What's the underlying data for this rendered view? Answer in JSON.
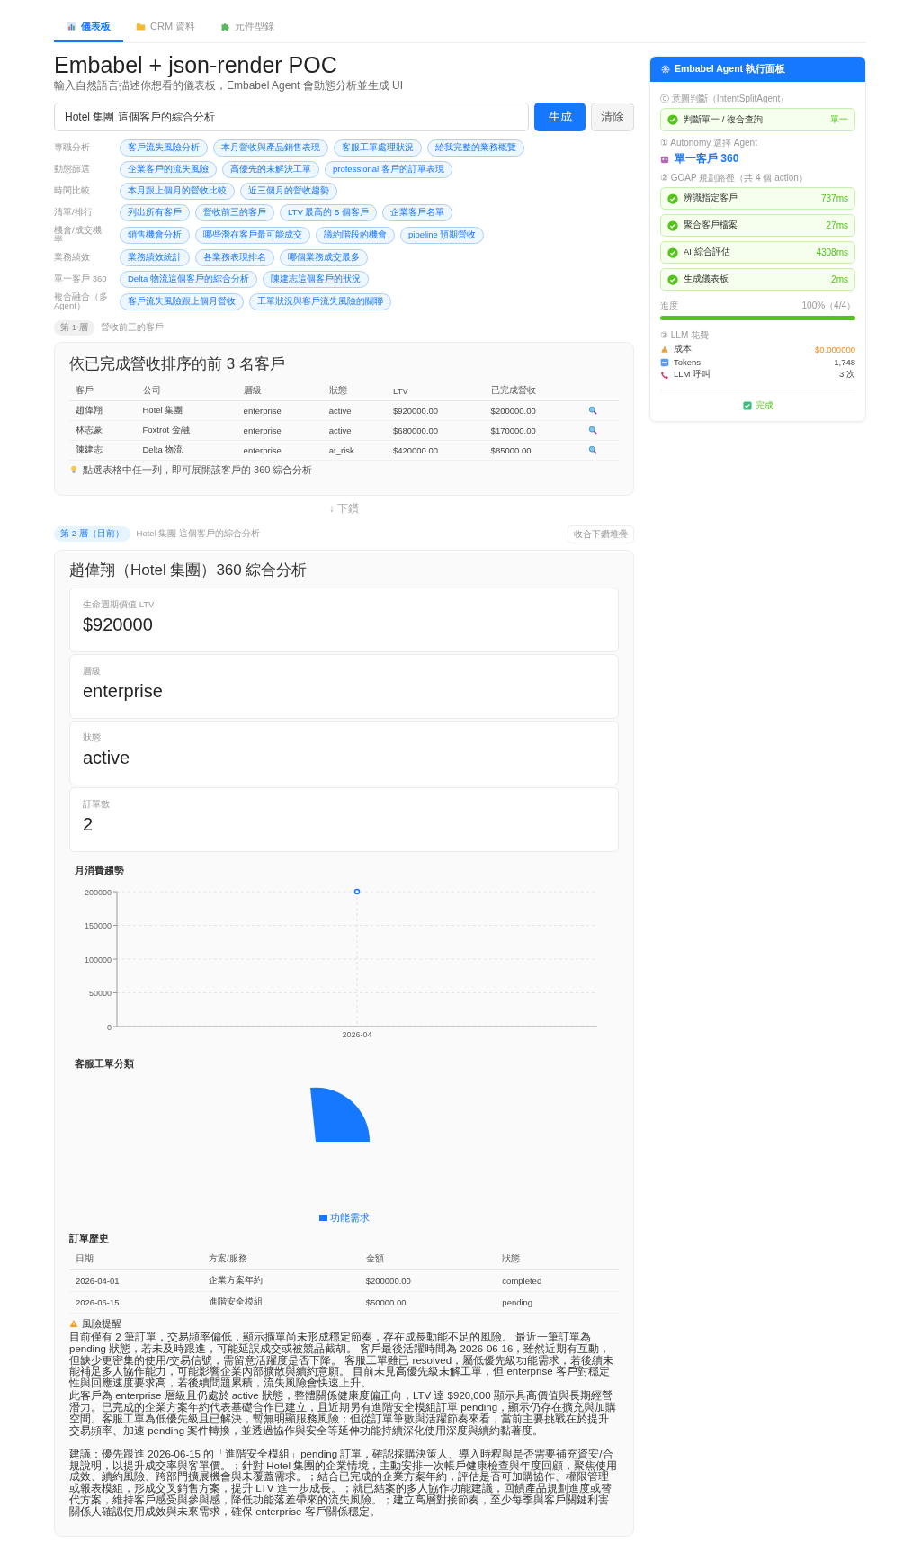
{
  "tabs": [
    {
      "label": "儀表板",
      "selected": true
    },
    {
      "label": "CRM 資料",
      "selected": false
    },
    {
      "label": "元件型錄",
      "selected": false
    }
  ],
  "header": {
    "title": "Embabel + json-render POC",
    "subtitle": "輸入自然語言描述你想看的儀表板，Embabel Agent 會動態分析並生成 UI"
  },
  "query": {
    "value": "Hotel 集團 這個客戶的綜合分析",
    "generate_button": "生成",
    "clear_button": "清除"
  },
  "suggestions": [
    {
      "category": "專職分析",
      "chips": [
        "客戶流失風險分析",
        "本月營收與產品銷售表現",
        "客服工單處理狀況",
        "給我完整的業務概覽"
      ]
    },
    {
      "category": "動態篩選",
      "chips": [
        "企業客戶的流失風險",
        "高優先的未解決工單",
        "professional 客戶的訂單表現"
      ]
    },
    {
      "category": "時間比較",
      "chips": [
        "本月跟上個月的營收比較",
        "近三個月的營收趨勢"
      ]
    },
    {
      "category": "清單/排行",
      "chips": [
        "列出所有客戶",
        "營收前三的客戶",
        "LTV 最高的 5 個客戶",
        "企業客戶名單"
      ]
    },
    {
      "category": "機會/成交機率",
      "chips": [
        "銷售機會分析",
        "哪些潛在客戶最可能成交",
        "議約階段的機會",
        "pipeline 預期營收"
      ]
    },
    {
      "category": "業務績效",
      "chips": [
        "業務績效統計",
        "各業務表現排名",
        "哪個業務成交最多"
      ]
    },
    {
      "category": "單一客戶 360",
      "chips": [
        "Delta 物流這個客戶的綜合分析",
        "陳建志這個客戶的狀況"
      ]
    },
    {
      "category": "複合融合（多 Agent）",
      "chips": [
        "客戶流失風險跟上個月營收",
        "工單狀況與客戶流失風險的關聯"
      ]
    }
  ],
  "layer_1": {
    "badge": "第 1 層",
    "caption": "營收前三的客戶",
    "current": false,
    "card": {
      "title": "依已完成營收排序的前 3 名客戶",
      "columns": [
        "客戶",
        "公司",
        "層級",
        "狀態",
        "LTV",
        "已完成營收"
      ],
      "rows": [
        [
          "趙偉翔",
          "Hotel 集團",
          "enterprise",
          "active",
          "$920000.00",
          "$200000.00"
        ],
        [
          "林志豪",
          "Foxtrot 金融",
          "enterprise",
          "active",
          "$680000.00",
          "$170000.00"
        ],
        [
          "陳建志",
          "Delta 物流",
          "enterprise",
          "at_risk",
          "$420000.00",
          "$85000.00"
        ]
      ],
      "hint": "點選表格中任一列，即可展開該客戶的 360 綜合分析"
    }
  },
  "drill_label": "↓ 下鑽",
  "layer_2": {
    "badge": "第 2 層（目前）",
    "caption": "Hotel 集團 這個客戶的綜合分析",
    "current": true,
    "collapse_button": "收合下鑽堆疊",
    "card": {
      "title": "趙偉翔（Hotel 集團）360 綜合分析",
      "stats": [
        {
          "label": "生命週期價值 LTV",
          "value": "$920000"
        },
        {
          "label": "層級",
          "value": "enterprise"
        },
        {
          "label": "狀態",
          "value": "active"
        },
        {
          "label": "訂單數",
          "value": "2"
        }
      ],
      "spend_chart": {
        "chart_data": {
          "type": "line",
          "title": "月消費趨勢",
          "categories": [
            "2026-04"
          ],
          "series": [
            {
              "color": "#1677ff",
              "marker": "circle",
              "values": [
                200000
              ]
            }
          ],
          "grid": true,
          "ylim": [
            0,
            200000
          ],
          "yticks": [
            0,
            50000,
            100000,
            150000,
            200000
          ]
        }
      },
      "ticket_chart": {
        "title": "客服工單分類",
        "legend": [
          "功能需求"
        ]
      },
      "orders": {
        "title": "訂單歷史",
        "columns": [
          "日期",
          "方案/服務",
          "金額",
          "狀態"
        ],
        "rows": [
          [
            "2026-04-01",
            "企業方案年約",
            "$200000.00",
            "completed"
          ],
          [
            "2026-06-15",
            "進階安全模組",
            "$50000.00",
            "pending"
          ]
        ]
      },
      "risk": {
        "title": "風險提醒",
        "paragraphs": [
          "目前僅有 2 筆訂單，交易頻率偏低，顯示擴單尚未形成穩定節奏，存在成長動能不足的風險。 最近一筆訂單為 pending 狀態，若未及時跟進，可能延誤成交或被競品截胡。 客戶最後活躍時間為 2026-06-16，雖然近期有互動，但缺少更密集的使用/交易信號，需留意活躍度是否下降。 客服工單雖已 resolved，屬低優先級功能需求，若後續未能補足多人協作能力，可能影響企業內部擴散與續約意願。 目前未見高優先級未解工單，但 enterprise 客戶對穩定性與回應速度要求高，若後續問題累積，流失風險會快速上升。",
          "此客戶為 enterprise 層級且仍處於 active 狀態，整體關係健康度偏正向，LTV 達 $920,000 顯示具高價值與長期經營潛力。已完成的企業方案年約代表基礎合作已建立，且近期另有進階安全模組訂單 pending，顯示仍存在擴充與加購空間。客服工單為低優先級且已解決，暫無明顯服務風險；但從訂單筆數與活躍節奏來看，當前主要挑戰在於提升交易頻率、加速 pending 案件轉換，並透過協作與安全等延伸功能持續深化使用深度與續約黏著度。",
          "建議：優先跟進 2026-06-15 的「進階安全模組」pending 訂單，確認採購決策人、導入時程與是否需要補充資安/合規說明，以提升成交率與客單價。；針對 Hotel 集團的企業情境，主動安排一次帳戶健康檢查與年度回顧，聚焦使用成效、續約風險、跨部門擴展機會與未覆蓋需求。；結合已完成的企業方案年約，評估是否可加購協作、權限管理或報表模組，形成交叉銷售方案，提升 LTV 進一步成長。；就已結案的多人協作功能建議，回饋產品規劃進度或替代方案，維持客戶感受與參與感，降低功能落差帶來的流失風險。；建立高層對接節奏，至少每季與客戶關鍵利害關係人確認使用成效與未來需求，確保 enterprise 客戶關係穩定。"
        ]
      }
    }
  },
  "agent_panel": {
    "title": "Embabel Agent 執行面板",
    "intent": {
      "label": "⓪ 意圖判斷（IntentSplitAgent）",
      "step": {
        "label": "判斷單一 / 複合查詢",
        "value": "單一",
        "done": true
      }
    },
    "autonomy": {
      "label": "① Autonomy 選擇 Agent",
      "agent": "單一客戶 360"
    },
    "goap": {
      "label": "② GOAP 規劃路徑（共 4 個 action）",
      "steps": [
        {
          "label": "辨識指定客戶",
          "value": "737ms",
          "done": true
        },
        {
          "label": "聚合客戶檔案",
          "value": "27ms",
          "done": true
        },
        {
          "label": "AI 綜合評估",
          "value": "4308ms",
          "done": true
        },
        {
          "label": "生成儀表板",
          "value": "2ms",
          "done": true
        }
      ]
    },
    "progress": {
      "label": "進度",
      "reading": "100%（4/4）",
      "level": 1
    },
    "llm": {
      "label": "③ LLM 花費",
      "rows": [
        {
          "kind": "cost",
          "label": "成本",
          "value": "$0.000000"
        },
        {
          "kind": "tokens",
          "label": "Tokens",
          "value": "1,748"
        },
        {
          "kind": "calls",
          "label": "LLM 呼叫",
          "value": "3 次"
        }
      ]
    },
    "status": "完成"
  }
}
